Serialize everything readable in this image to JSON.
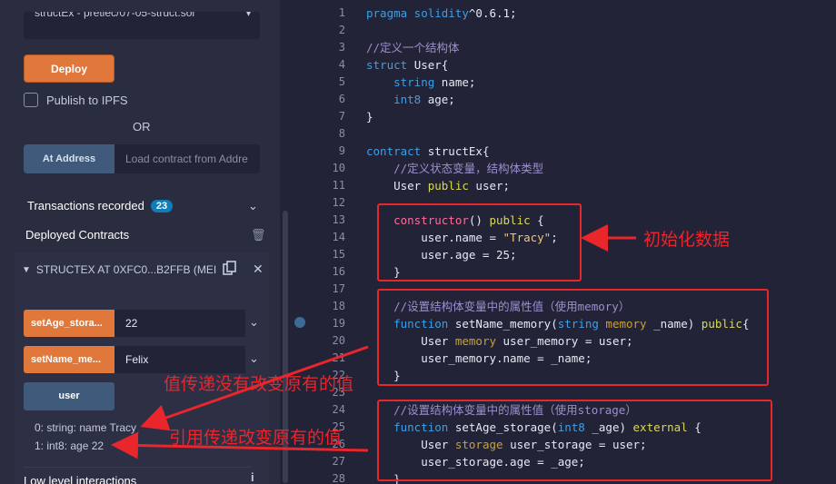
{
  "left_panel": {
    "contract_select": {
      "value": "structEx - pretiec/07-05-struct.sol"
    },
    "deploy_label": "Deploy",
    "publish_ipfs_label": "Publish to IPFS",
    "or_label": "OR",
    "at_address_label": "At Address",
    "load_contract_placeholder": "Load contract from Addre",
    "transactions_recorded_label": "Transactions recorded",
    "transactions_count": "23",
    "deployed_contracts_label": "Deployed Contracts",
    "instance": {
      "title": "STRUCTEX AT 0XFC0...B2FFB (MEI",
      "functions": [
        {
          "label": "setAge_stora...",
          "value": "22"
        },
        {
          "label": "setName_me...",
          "value": "Felix"
        }
      ],
      "user_button_label": "user",
      "outputs": [
        "0: string: name Tracy",
        "1: int8: age 22"
      ]
    },
    "low_level_label": "Low level interactions"
  },
  "editor": {
    "line_numbers": [
      "1",
      "2",
      "3",
      "4",
      "5",
      "6",
      "7",
      "8",
      "9",
      "10",
      "11",
      "12",
      "13",
      "14",
      "15",
      "16",
      "17",
      "18",
      "19",
      "20",
      "21",
      "22",
      "23",
      "24",
      "25",
      "26",
      "27",
      "28"
    ],
    "lines": [
      [
        {
          "t": "pragma solidity",
          "c": "kw"
        },
        {
          "t": "^0.6.1;",
          "c": "def"
        }
      ],
      [],
      [
        {
          "t": "//定义一个结构体",
          "c": "cm"
        }
      ],
      [
        {
          "t": "struct ",
          "c": "kw"
        },
        {
          "t": "User{",
          "c": "def"
        }
      ],
      [
        {
          "t": "    string ",
          "c": "ty"
        },
        {
          "t": "name;",
          "c": "def"
        }
      ],
      [
        {
          "t": "    int8 ",
          "c": "ty"
        },
        {
          "t": "age;",
          "c": "def"
        }
      ],
      [
        {
          "t": "}",
          "c": "def"
        }
      ],
      [],
      [
        {
          "t": "contract ",
          "c": "kw"
        },
        {
          "t": "structEx{",
          "c": "def"
        }
      ],
      [
        {
          "t": "    //定义状态变量，结构体类型",
          "c": "cm"
        }
      ],
      [
        {
          "t": "    User ",
          "c": "def"
        },
        {
          "t": "public ",
          "c": "pub"
        },
        {
          "t": "user;",
          "c": "def"
        }
      ],
      [],
      [
        {
          "t": "    constructor",
          "c": "ctor"
        },
        {
          "t": "() ",
          "c": "def"
        },
        {
          "t": "public ",
          "c": "pub"
        },
        {
          "t": "{",
          "c": "def"
        }
      ],
      [
        {
          "t": "        user.name = ",
          "c": "def"
        },
        {
          "t": "\"Tracy\"",
          "c": "str"
        },
        {
          "t": ";",
          "c": "def"
        }
      ],
      [
        {
          "t": "        user.age = 25;",
          "c": "def"
        }
      ],
      [
        {
          "t": "    }",
          "c": "def"
        }
      ],
      [],
      [
        {
          "t": "    //设置结构体变量中的属性值（使用memory）",
          "c": "cm"
        }
      ],
      [
        {
          "t": "    function ",
          "c": "kw"
        },
        {
          "t": "setName_memory(",
          "c": "def"
        },
        {
          "t": "string ",
          "c": "ty"
        },
        {
          "t": "memory ",
          "c": "mem"
        },
        {
          "t": "_name) ",
          "c": "def"
        },
        {
          "t": "public",
          "c": "pub"
        },
        {
          "t": "{",
          "c": "def"
        }
      ],
      [
        {
          "t": "        User ",
          "c": "def"
        },
        {
          "t": "memory ",
          "c": "mem"
        },
        {
          "t": "user_memory = user;",
          "c": "def"
        }
      ],
      [
        {
          "t": "        user_memory.name = _name;",
          "c": "def"
        }
      ],
      [
        {
          "t": "    }",
          "c": "def"
        }
      ],
      [],
      [
        {
          "t": "    //设置结构体变量中的属性值（使用storage）",
          "c": "cm"
        }
      ],
      [
        {
          "t": "    function ",
          "c": "kw"
        },
        {
          "t": "setAge_storage(",
          "c": "def"
        },
        {
          "t": "int8 ",
          "c": "ty"
        },
        {
          "t": "_age) ",
          "c": "def"
        },
        {
          "t": "external ",
          "c": "pub"
        },
        {
          "t": "{",
          "c": "def"
        }
      ],
      [
        {
          "t": "        User ",
          "c": "def"
        },
        {
          "t": "storage ",
          "c": "mem"
        },
        {
          "t": "user_storage = user;",
          "c": "def"
        }
      ],
      [
        {
          "t": "        user_storage.age = _age;",
          "c": "def"
        }
      ],
      [
        {
          "t": "    }",
          "c": "def"
        }
      ]
    ]
  },
  "annotations": {
    "init_data": "初始化数据",
    "value_pass": "值传递没有改变原有的值",
    "ref_pass": "引用传递改变原有的值",
    "color": "#e8262c"
  }
}
